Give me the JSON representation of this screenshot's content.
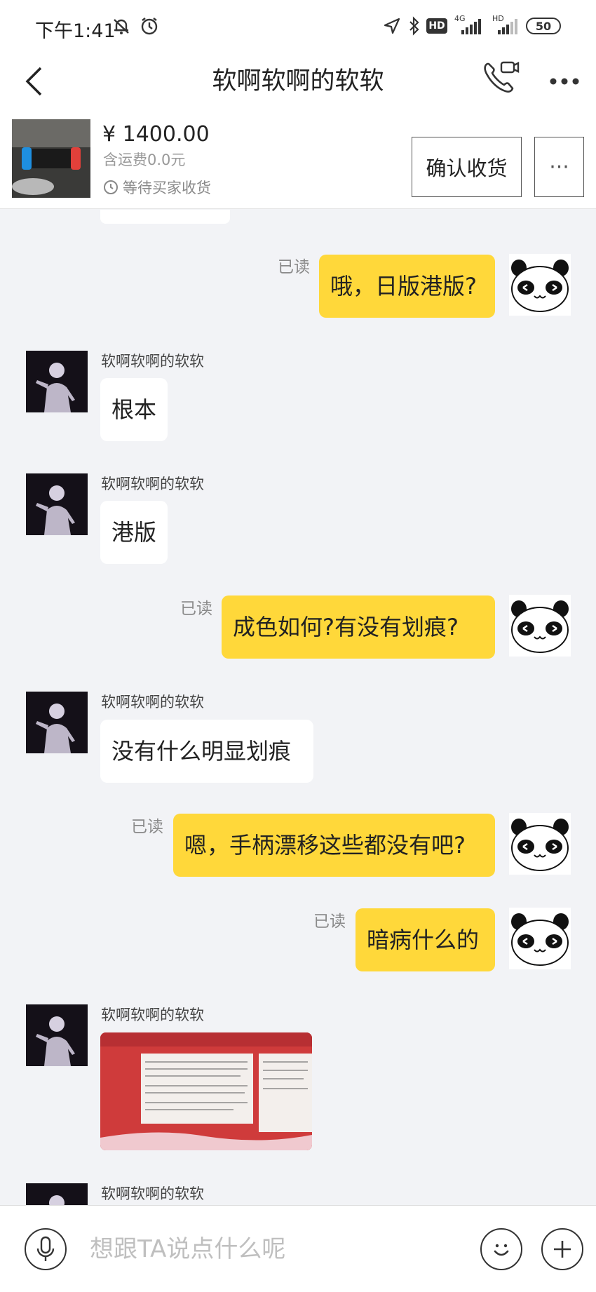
{
  "status_bar": {
    "time": "下午1:41",
    "hd_label": "HD",
    "net_4g": "4G",
    "hd2_label": "HD",
    "battery": "50"
  },
  "header": {
    "back_icon": "chevron-left-icon",
    "title": "软啊软啊的软软",
    "call_icon": "video-call-icon",
    "more_icon": "more-dots-icon"
  },
  "product": {
    "price": "¥ 1400.00",
    "shipping": "含运费0.0元",
    "status": "等待买家收货",
    "confirm_label": "确认收货",
    "more_label": "···"
  },
  "messages": [
    {
      "from": "me",
      "text": "哦，日版港版?",
      "read": "已读"
    },
    {
      "from": "them",
      "sender": "软啊软啊的软软",
      "text": "根本"
    },
    {
      "from": "them",
      "sender": "软啊软啊的软软",
      "text": "港版"
    },
    {
      "from": "me",
      "text": "成色如何?有没有划痕?",
      "read": "已读"
    },
    {
      "from": "them",
      "sender": "软啊软啊的软软",
      "text": "没有什么明显划痕"
    },
    {
      "from": "me",
      "text": "嗯，手柄漂移这些都没有吧?",
      "read": "已读"
    },
    {
      "from": "me",
      "text": "暗病什么的",
      "read": "已读"
    },
    {
      "from": "them",
      "sender": "软啊软啊的软软",
      "type": "image"
    },
    {
      "from": "them",
      "sender": "软啊软啊的软软",
      "type": "partial"
    }
  ],
  "input_bar": {
    "placeholder": "想跟TA说点什么呢",
    "value": "",
    "mic_icon": "microphone-icon",
    "emoji_icon": "smiley-icon",
    "plus_icon": "plus-icon"
  },
  "colors": {
    "my_bubble": "#ffd83a",
    "their_bubble": "#ffffff",
    "background": "#f2f3f6"
  }
}
